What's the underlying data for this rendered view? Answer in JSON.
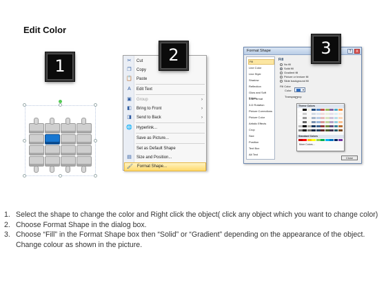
{
  "title": "Edit Color",
  "badges": [
    "1",
    "2",
    "3"
  ],
  "context_menu": {
    "items": [
      {
        "label": "Cut",
        "icon": "scissors-icon",
        "glyph": "✂"
      },
      {
        "label": "Copy",
        "icon": "copy-icon",
        "glyph": "❐"
      },
      {
        "label": "Paste",
        "icon": "paste-icon",
        "glyph": "📋"
      },
      {
        "label": "Edit Text",
        "icon": "edit-text-icon",
        "glyph": "A"
      },
      {
        "label": "Group",
        "icon": "group-icon",
        "glyph": "▣"
      },
      {
        "label": "Bring to Front",
        "icon": "bring-front-icon",
        "glyph": "◧"
      },
      {
        "label": "Send to Back",
        "icon": "send-back-icon",
        "glyph": "◨"
      },
      {
        "label": "Hyperlink...",
        "icon": "hyperlink-icon",
        "glyph": "🌐"
      },
      {
        "label": "Save as Picture...",
        "icon": "",
        "glyph": ""
      },
      {
        "label": "Set as Default Shape",
        "icon": "",
        "glyph": ""
      },
      {
        "label": "Size and Position...",
        "icon": "size-icon",
        "glyph": "▤"
      },
      {
        "label": "Format Shape...",
        "icon": "format-shape-icon",
        "glyph": "🖌"
      }
    ],
    "submenu_arrow": "›"
  },
  "dialog": {
    "title": "Format Shape",
    "help": "?",
    "close": "X",
    "categories": [
      "Fill",
      "Line Color",
      "Line Style",
      "Shadow",
      "Reflection",
      "Glow and Soft Edges",
      "3-D Format",
      "3-D Rotation",
      "Picture Corrections",
      "Picture Color",
      "Artistic Effects",
      "Crop",
      "Size",
      "Position",
      "Text Box",
      "Alt Text"
    ],
    "fill_heading": "Fill",
    "fill_options": [
      "No fill",
      "Solid fill",
      "Gradient fill",
      "Picture or texture fill",
      "Slide background fill"
    ],
    "fill_color_heading": "Fill Color",
    "color_label": "Color:",
    "transparency_label": "Transparency:",
    "palette_theme_heading": "Theme Colors",
    "palette_standard_heading": "Standard Colors",
    "more_colors": "More Colors...",
    "close_button": "Close",
    "theme_colors": [
      "#ffffff",
      "#000000",
      "#eeece1",
      "#1f497d",
      "#4f81bd",
      "#c0504d",
      "#9bbb59",
      "#8064a2",
      "#4bacc6",
      "#f79646"
    ],
    "standard_colors": [
      "#c00000",
      "#ff0000",
      "#ffc000",
      "#ffff00",
      "#92d050",
      "#00b050",
      "#00b0f0",
      "#0070c0",
      "#002060",
      "#7030a0"
    ]
  },
  "steps": [
    {
      "n": "1.",
      "text": "Select the shape to change the color and Right click the object( click any object which you want to change color)"
    },
    {
      "n": "2.",
      "text": "Choose Format Shape in the dialog box."
    },
    {
      "n": "3.",
      "text": "Choose “Fill” in the Format Shape box then “Solid” or “Gradient” depending on the appearance of the object. Change colour as shown in the picture."
    }
  ],
  "colors": {
    "accent_blue": "#1877d1",
    "puzzle_gray": "#cfcfcf",
    "menu_highlight": "#ffd96b"
  }
}
